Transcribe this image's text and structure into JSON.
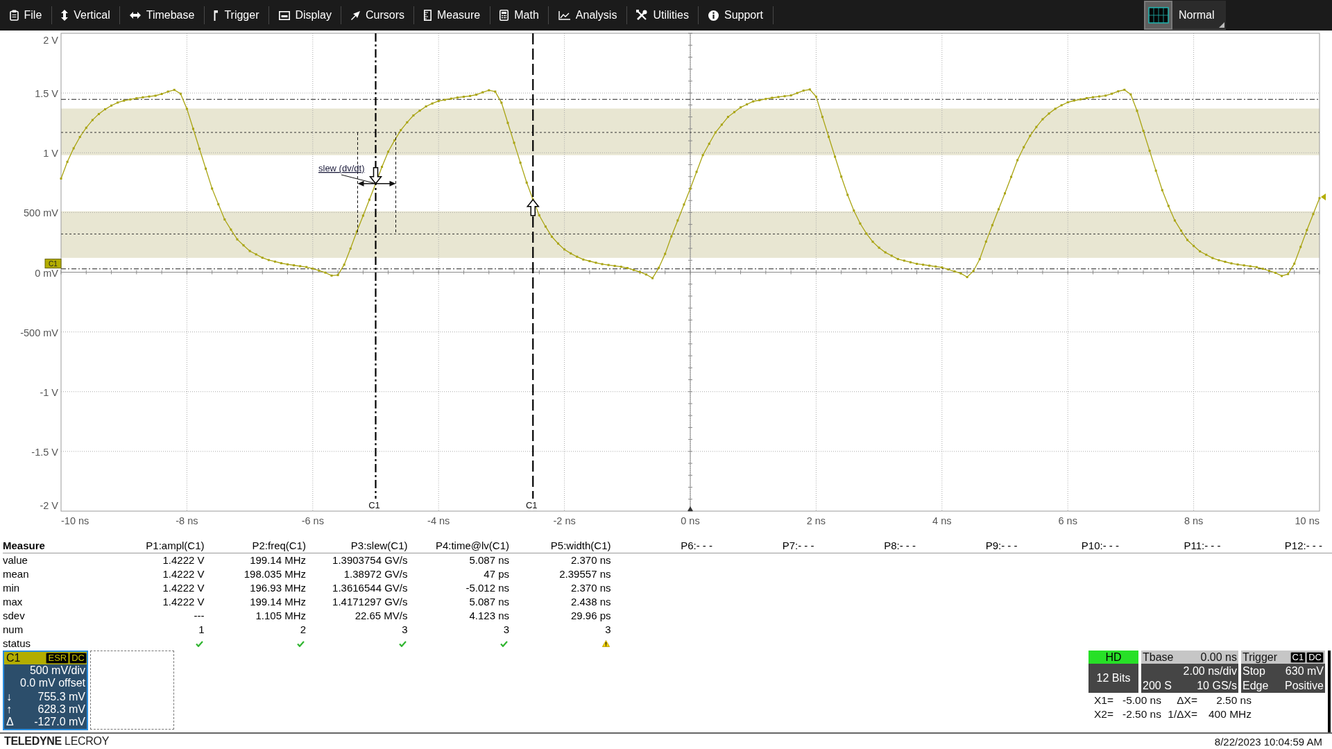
{
  "menu": {
    "items": [
      "File",
      "Vertical",
      "Timebase",
      "Trigger",
      "Display",
      "Cursors",
      "Measure",
      "Math",
      "Analysis",
      "Utilities",
      "Support"
    ],
    "mode": "Normal"
  },
  "plot": {
    "y_labels": [
      "2 V",
      "1.5 V",
      "1 V",
      "500 mV",
      "0 mV",
      "-500 mV",
      "-1 V",
      "-1.5 V",
      "-2 V"
    ],
    "x_labels": [
      "-10 ns",
      "-8 ns",
      "-6 ns",
      "-4 ns",
      "-2 ns",
      "0 ns",
      "2 ns",
      "4 ns",
      "6 ns",
      "8 ns",
      "10 ns"
    ],
    "channel_tag": "C1",
    "cursors": [
      {
        "label": "C1",
        "kind": "dashdot"
      },
      {
        "label": "C1",
        "kind": "dashed"
      }
    ],
    "annotation": "slew (dv/dt)"
  },
  "measure": {
    "title": "Measure",
    "rows": [
      "value",
      "mean",
      "min",
      "max",
      "sdev",
      "num"
    ],
    "status_label": "status",
    "columns": [
      {
        "header": "P1:ampl(C1)",
        "cells": [
          "1.4222 V",
          "1.4222 V",
          "1.4222 V",
          "1.4222 V",
          "---",
          "1"
        ],
        "warning": false
      },
      {
        "header": "P2:freq(C1)",
        "cells": [
          "199.14 MHz",
          "198.035 MHz",
          "196.93 MHz",
          "199.14 MHz",
          "1.105 MHz",
          "2"
        ],
        "warning": false
      },
      {
        "header": "P3:slew(C1)",
        "cells": [
          "1.3903754 GV/s",
          "1.38972 GV/s",
          "1.3616544 GV/s",
          "1.4171297 GV/s",
          "22.65 MV/s",
          "3"
        ],
        "warning": false
      },
      {
        "header": "P4:time@lv(C1)",
        "cells": [
          "5.087 ns",
          "47 ps",
          "-5.012 ns",
          "5.087 ns",
          "4.123 ns",
          "3"
        ],
        "warning": false
      },
      {
        "header": "P5:width(C1)",
        "cells": [
          "2.370 ns",
          "2.39557 ns",
          "2.370 ns",
          "2.438 ns",
          "29.96 ps",
          "3"
        ],
        "warning": true
      },
      {
        "header": "P6:- - -"
      },
      {
        "header": "P7:- - -"
      },
      {
        "header": "P8:- - -"
      },
      {
        "header": "P9:- - -"
      },
      {
        "header": "P10:- - -"
      },
      {
        "header": "P11:- - -"
      },
      {
        "header": "P12:- - -"
      }
    ]
  },
  "channel": {
    "name": "C1",
    "selected": true,
    "badges": [
      "ESR",
      "DC"
    ],
    "scale": "500 mV/div",
    "offset": "0.0 mV offset",
    "readouts": [
      {
        "symbol": "↓",
        "value": "755.3 mV"
      },
      {
        "symbol": "↑",
        "value": "628.3 mV"
      },
      {
        "symbol": "Δ",
        "value": "-127.0 mV"
      }
    ]
  },
  "acquisition": {
    "mode": "HD",
    "resolution": "12 Bits"
  },
  "timebase": {
    "title": "Tbase",
    "delay": "0.00 ns",
    "scale": "2.00 ns/div",
    "samples": "200 S",
    "rate": "10 GS/s"
  },
  "trigger": {
    "title": "Trigger",
    "badges": [
      "C1",
      "DC"
    ],
    "state": "Stop",
    "level": "630 mV",
    "type": "Edge",
    "slope": "Positive"
  },
  "cursor_readout": [
    {
      "label": "X1=",
      "value": "-5.00 ns",
      "delta_label": "ΔX=",
      "delta_value": "2.50 ns"
    },
    {
      "label": "X2=",
      "value": "-2.50 ns",
      "delta_label": "1/ΔX=",
      "delta_value": "400 MHz"
    }
  ],
  "footer": {
    "logo": "**TELEDYNE** LECROY",
    "timestamp": "8/22/2023 10:04:59 AM"
  }
}
